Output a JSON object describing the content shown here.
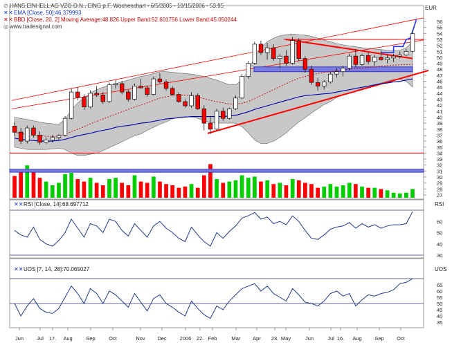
{
  "header": {
    "title": "HANS EINHELL AG VZO O.N., EING p.F, Wochenchart - 6/5/2005 - 10/15/2006 - 53.95",
    "ema_legend": "EMA [Close, 50]:46.379993",
    "bbd_legend": "BBD [Close, 20, 2] Moving Average:48.826 Upper Band:52.601756 Lower Band:45.050244",
    "source": "www.tradesignal.com"
  },
  "panels": {
    "price_unit": "EUR",
    "rsi_legend": "RSI [Close, 14]:68.697712",
    "rsi_unit": "RSI",
    "uos_legend": "UOS [7, 14, 28]:70.065027",
    "uos_unit": "UOS"
  },
  "x_labels": [
    "Jun",
    "Jul",
    "17.",
    "Aug",
    "Sep",
    "Oct",
    "Nov",
    "Dec",
    "2006",
    "22.",
    "Feb",
    "Mar",
    "Apr",
    "23.",
    "May",
    "Jun",
    "Jul",
    "16.",
    "Aug",
    "Sep",
    "Oct"
  ],
  "colors": {
    "up": "#00cc00",
    "down": "#ff0000",
    "ema": "#0000aa",
    "band_fill": "#c8c8c8",
    "ma_line": "#cc0000",
    "trend": "#ff0000",
    "blue_box": "#3333bb",
    "rsi_line": "#1f3b8a"
  },
  "chart_data": [
    {
      "type": "candlestick",
      "title": "HANS EINHELL AG VZO O.N., EING p.F, Wochenchart - 6/5/2005 - 10/15/2006 - 53.95",
      "unit": "EUR",
      "ylim": [
        26,
        57
      ],
      "y_ticks": [
        56,
        55,
        54,
        53,
        52,
        51,
        50,
        49,
        48,
        47,
        46,
        45,
        44,
        43,
        42,
        41,
        40,
        39,
        38,
        37,
        36,
        35,
        34,
        33,
        32,
        31,
        30,
        29,
        28,
        27
      ],
      "x_tick_labels": [
        "Jun",
        "Jul",
        "17.",
        "Aug",
        "Sep",
        "Oct",
        "Nov",
        "Dec",
        "2006",
        "22.",
        "Feb",
        "Mar",
        "Apr",
        "23.",
        "May",
        "Jun",
        "Jul",
        "16.",
        "Aug",
        "Sep",
        "Oct"
      ],
      "ohlc": [
        [
          38.5,
          39.2,
          36.8,
          37.5
        ],
        [
          37.5,
          38.2,
          35.5,
          36.0
        ],
        [
          36.0,
          38.6,
          35.6,
          38.2
        ],
        [
          38.2,
          38.6,
          36.6,
          37.0
        ],
        [
          37.0,
          37.6,
          35.4,
          35.8
        ],
        [
          35.8,
          36.6,
          35.5,
          36.2
        ],
        [
          36.2,
          37.0,
          35.8,
          36.6
        ],
        [
          36.6,
          37.2,
          36.2,
          36.9
        ],
        [
          37.0,
          40.2,
          36.8,
          39.8
        ],
        [
          39.8,
          44.8,
          39.6,
          44.2
        ],
        [
          44.2,
          45.0,
          42.8,
          43.3
        ],
        [
          43.3,
          43.8,
          41.2,
          41.7
        ],
        [
          41.7,
          44.5,
          41.5,
          44.0
        ],
        [
          44.0,
          45.2,
          43.4,
          43.7
        ],
        [
          43.7,
          44.2,
          42.2,
          42.6
        ],
        [
          42.6,
          45.8,
          42.4,
          45.4
        ],
        [
          45.4,
          46.2,
          44.8,
          45.6
        ],
        [
          45.6,
          46.1,
          43.8,
          44.2
        ],
        [
          44.2,
          44.6,
          42.6,
          43.0
        ],
        [
          43.0,
          45.6,
          42.8,
          45.2
        ],
        [
          45.2,
          46.4,
          44.8,
          44.9
        ],
        [
          44.9,
          45.3,
          43.4,
          43.8
        ],
        [
          43.8,
          46.8,
          43.6,
          46.4
        ],
        [
          46.4,
          47.3,
          45.6,
          45.9
        ],
        [
          45.9,
          46.3,
          44.4,
          44.8
        ],
        [
          44.8,
          45.2,
          43.6,
          43.8
        ],
        [
          43.8,
          44.2,
          42.4,
          42.6
        ],
        [
          42.6,
          43.0,
          41.6,
          41.9
        ],
        [
          41.9,
          44.2,
          41.6,
          43.6
        ],
        [
          43.6,
          44.0,
          41.2,
          41.4
        ],
        [
          41.4,
          42.0,
          37.8,
          39.0
        ],
        [
          39.0,
          40.2,
          37.2,
          38.0
        ],
        [
          38.0,
          41.4,
          37.8,
          41.0
        ],
        [
          41.0,
          41.6,
          39.4,
          39.8
        ],
        [
          39.8,
          41.6,
          39.6,
          41.4
        ],
        [
          41.4,
          43.6,
          41.2,
          43.2
        ],
        [
          43.2,
          47.2,
          43.0,
          46.8
        ],
        [
          46.8,
          49.4,
          46.4,
          49.0
        ],
        [
          49.0,
          52.6,
          48.8,
          52.2
        ],
        [
          52.2,
          52.8,
          50.4,
          50.8
        ],
        [
          50.8,
          52.4,
          49.6,
          51.6
        ],
        [
          51.6,
          52.2,
          49.4,
          49.8
        ],
        [
          49.8,
          50.6,
          48.2,
          50.2
        ],
        [
          50.2,
          51.2,
          48.6,
          49.0
        ],
        [
          49.0,
          53.4,
          48.8,
          52.8
        ],
        [
          52.8,
          53.2,
          49.4,
          49.8
        ],
        [
          49.8,
          50.2,
          47.4,
          48.0
        ],
        [
          48.0,
          48.6,
          45.4,
          45.8
        ],
        [
          45.8,
          46.6,
          44.4,
          45.2
        ],
        [
          45.2,
          46.2,
          44.6,
          45.9
        ],
        [
          45.9,
          47.6,
          45.6,
          47.2
        ],
        [
          47.2,
          48.2,
          46.6,
          47.6
        ],
        [
          47.6,
          48.6,
          46.8,
          48.2
        ],
        [
          48.2,
          50.6,
          47.8,
          50.2
        ],
        [
          50.2,
          51.4,
          48.4,
          48.8
        ],
        [
          48.8,
          50.6,
          48.6,
          50.3
        ],
        [
          50.3,
          50.8,
          48.8,
          49.3
        ],
        [
          49.3,
          50.4,
          48.6,
          50.0
        ],
        [
          50.0,
          51.2,
          49.4,
          49.6
        ],
        [
          49.6,
          50.5,
          49.0,
          49.9
        ],
        [
          49.9,
          50.6,
          49.2,
          50.2
        ],
        [
          50.2,
          51.0,
          49.8,
          50.4
        ],
        [
          50.4,
          51.4,
          50.2,
          51.0
        ],
        [
          51.0,
          54.6,
          50.8,
          53.95
        ]
      ],
      "ema_50": [
        36.5,
        36.3,
        36.2,
        36.1,
        36.0,
        36.0,
        36.0,
        36.1,
        36.3,
        36.6,
        36.9,
        37.1,
        37.3,
        37.6,
        37.8,
        38.0,
        38.3,
        38.5,
        38.6,
        38.8,
        39.0,
        39.1,
        39.3,
        39.5,
        39.7,
        39.8,
        39.9,
        40.0,
        40.1,
        40.1,
        40.1,
        40.1,
        40.1,
        40.1,
        40.2,
        40.3,
        40.6,
        40.9,
        41.3,
        41.6,
        41.9,
        42.2,
        42.5,
        42.8,
        43.1,
        43.4,
        43.6,
        43.7,
        43.8,
        43.9,
        44.0,
        44.2,
        44.4,
        44.6,
        44.8,
        45.0,
        45.2,
        45.4,
        45.6,
        45.7,
        45.9,
        46.0,
        46.2,
        46.38
      ],
      "bb_middle": [
        37.5,
        37.3,
        37.1,
        37.0,
        36.9,
        36.8,
        36.8,
        36.8,
        37.1,
        37.6,
        38.0,
        38.4,
        38.9,
        39.3,
        39.7,
        40.1,
        40.5,
        40.9,
        41.3,
        41.7,
        42.0,
        42.4,
        42.8,
        43.2,
        43.4,
        43.6,
        43.7,
        43.7,
        43.6,
        43.4,
        43.1,
        42.8,
        42.6,
        42.4,
        42.2,
        42.2,
        42.3,
        42.6,
        43.1,
        43.6,
        44.1,
        44.6,
        45.1,
        45.6,
        46.1,
        46.5,
        46.8,
        47.1,
        47.3,
        47.5,
        47.6,
        47.8,
        47.9,
        48.0,
        48.1,
        48.2,
        48.3,
        48.4,
        48.5,
        48.6,
        48.7,
        48.75,
        48.8,
        48.826
      ],
      "bb_upper": [
        40.0,
        39.8,
        39.6,
        39.4,
        39.2,
        39.0,
        38.9,
        38.8,
        39.6,
        41.2,
        42.4,
        43.2,
        44.0,
        44.6,
        45.0,
        45.3,
        45.6,
        45.9,
        46.2,
        46.5,
        46.8,
        47.0,
        47.3,
        47.6,
        47.6,
        47.5,
        47.4,
        47.3,
        47.2,
        47.0,
        46.8,
        46.5,
        46.2,
        45.8,
        45.4,
        45.4,
        46.2,
        47.8,
        50.0,
        51.6,
        52.6,
        53.2,
        53.6,
        53.8,
        53.9,
        53.8,
        53.7,
        53.5,
        53.2,
        52.9,
        52.6,
        52.3,
        52.1,
        51.9,
        51.8,
        51.6,
        51.5,
        51.4,
        51.3,
        51.2,
        51.1,
        51.2,
        51.6,
        52.6
      ],
      "bb_lower": [
        35.0,
        34.8,
        34.6,
        34.6,
        34.6,
        34.6,
        34.7,
        34.8,
        34.6,
        34.0,
        33.6,
        33.6,
        33.8,
        34.0,
        34.4,
        34.9,
        35.4,
        35.9,
        36.4,
        36.9,
        37.2,
        37.8,
        38.3,
        38.8,
        39.2,
        39.7,
        40.0,
        40.1,
        40.0,
        39.8,
        39.4,
        39.1,
        39.0,
        39.0,
        39.0,
        39.0,
        38.4,
        37.4,
        36.2,
        35.6,
        35.6,
        36.0,
        36.6,
        37.4,
        38.3,
        39.2,
        39.9,
        40.7,
        41.4,
        42.1,
        42.6,
        43.3,
        43.7,
        44.1,
        44.4,
        44.8,
        45.1,
        45.4,
        45.7,
        46.0,
        46.3,
        46.3,
        46.0,
        45.05
      ],
      "volume": [
        3.5,
        4.6,
        5.2,
        4.2,
        3.2,
        2.6,
        2.0,
        2.4,
        3.8,
        4.0,
        3.0,
        2.6,
        3.2,
        2.4,
        2.0,
        3.0,
        3.2,
        2.4,
        2.0,
        3.6,
        2.6,
        2.4,
        3.4,
        2.6,
        2.2,
        2.0,
        1.6,
        1.8,
        2.2,
        1.6,
        3.6,
        5.4,
        3.0,
        2.4,
        2.6,
        2.8,
        3.6,
        3.2,
        3.4,
        2.6,
        2.8,
        2.2,
        2.4,
        2.0,
        3.0,
        2.8,
        2.4,
        2.2,
        1.6,
        1.8,
        2.2,
        1.8,
        2.0,
        2.4,
        2.2,
        1.8,
        1.6,
        1.6,
        1.4,
        1.2,
        0.8,
        0.7,
        0.8,
        1.4
      ],
      "volume_axis_ticks": [
        32,
        31,
        30,
        29,
        28,
        27
      ],
      "horizontal_lines": [
        34,
        53
      ],
      "price_box": [
        47.6,
        48.4
      ],
      "volume_box": [
        30.8,
        31.3
      ]
    },
    {
      "type": "line",
      "title": "RSI [Close, 14]:68.697712",
      "unit": "RSI",
      "ylim": [
        26,
        74
      ],
      "y_ticks": [
        60,
        50,
        40,
        30
      ],
      "reference_lines": [
        70,
        30
      ],
      "values": [
        52,
        48,
        46,
        55,
        44,
        40,
        38,
        43,
        50,
        62,
        54,
        46,
        58,
        56,
        50,
        62,
        60,
        52,
        47,
        58,
        52,
        46,
        56,
        60,
        54,
        50,
        45,
        42,
        55,
        48,
        42,
        38,
        50,
        45,
        51,
        56,
        63,
        65,
        68,
        62,
        64,
        58,
        60,
        57,
        65,
        60,
        52,
        45,
        44,
        48,
        53,
        55,
        56,
        59,
        54,
        58,
        55,
        57,
        54,
        56,
        57,
        57,
        58,
        68.7
      ]
    },
    {
      "type": "line",
      "title": "UOS [7, 14, 28]:70.065027",
      "unit": "UOS",
      "ylim": [
        33,
        78
      ],
      "y_ticks": [
        65,
        60,
        55,
        50,
        45,
        40,
        35
      ],
      "reference_lines": [
        70,
        50
      ],
      "values": [
        50,
        40,
        48,
        54,
        46,
        43,
        42,
        46,
        55,
        64,
        58,
        50,
        62,
        58,
        50,
        60,
        57,
        52,
        47,
        58,
        51,
        44,
        54,
        57,
        50,
        47,
        43,
        40,
        52,
        46,
        41,
        38,
        48,
        45,
        52,
        57,
        62,
        64,
        66,
        60,
        64,
        58,
        55,
        52,
        62,
        57,
        51,
        50,
        48,
        52,
        58,
        60,
        56,
        58,
        48,
        53,
        57,
        56,
        58,
        59,
        61,
        66,
        67,
        70.07
      ]
    }
  ]
}
